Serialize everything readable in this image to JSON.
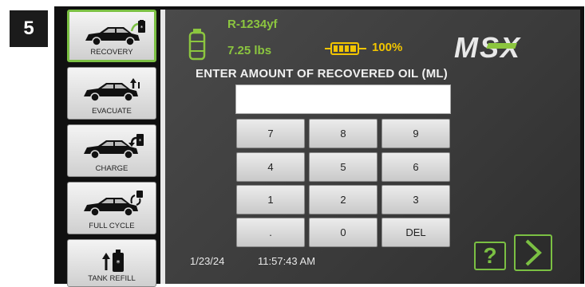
{
  "step_number": "5",
  "sidebar": {
    "items": [
      {
        "label": "RECOVERY",
        "icon": "car-recovery-icon",
        "active": true
      },
      {
        "label": "EVACUATE",
        "icon": "car-evacuate-icon",
        "active": false
      },
      {
        "label": "CHARGE",
        "icon": "car-charge-icon",
        "active": false
      },
      {
        "label": "FULL CYCLE",
        "icon": "car-full-cycle-icon",
        "active": false
      },
      {
        "label": "TANK REFILL",
        "icon": "tank-refill-icon",
        "active": false
      }
    ]
  },
  "status": {
    "refrigerant": "R-1234yf",
    "weight": "7.25 lbs",
    "battery_percent": "100%",
    "logo": "MSX"
  },
  "prompt": "ENTER AMOUNT OF RECOVERED OIL (ML)",
  "entry": {
    "value": ""
  },
  "keypad": {
    "keys": [
      "7",
      "8",
      "9",
      "4",
      "5",
      "6",
      "1",
      "2",
      "3",
      ".",
      "0",
      "DEL"
    ]
  },
  "footer": {
    "date": "1/23/24",
    "time": "11:57:43 AM",
    "help_label": "?",
    "help_icon": "help-icon",
    "next_icon": "chevron-right-icon"
  },
  "colors": {
    "accent_green": "#8cc63f",
    "active_border": "#7bc043",
    "battery_yellow": "#f2c500",
    "screen_background": "#3e3e3e"
  }
}
